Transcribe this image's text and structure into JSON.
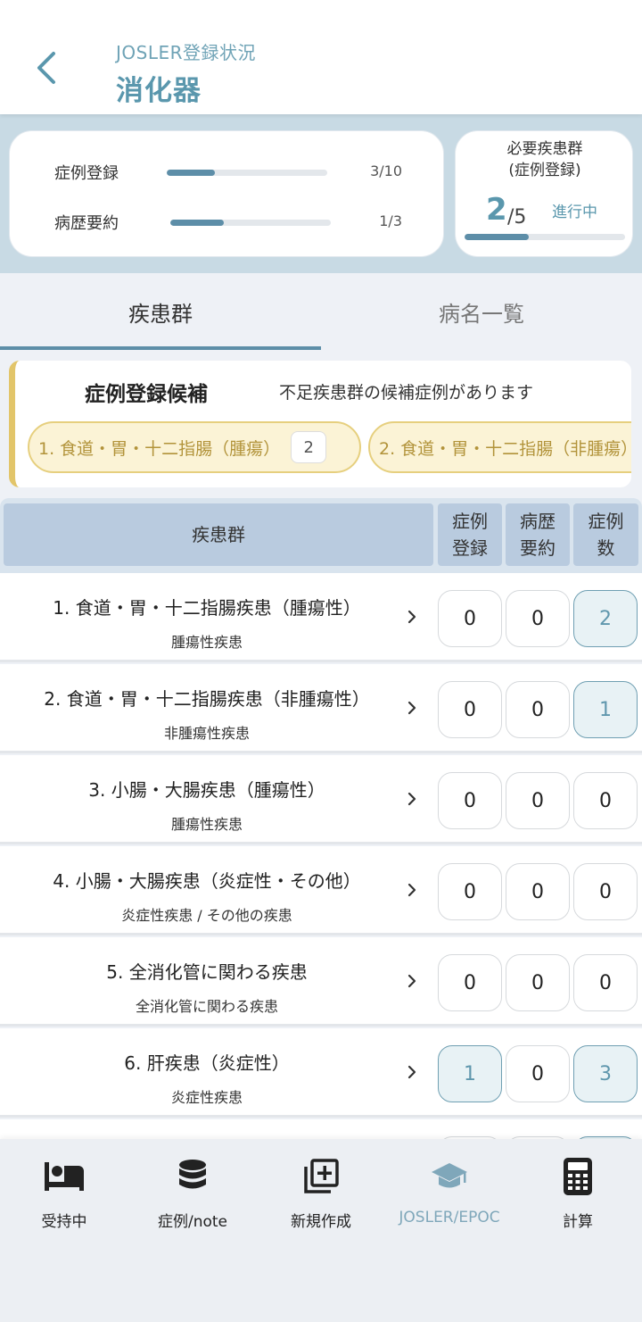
{
  "header": {
    "subtitle": "JOSLER登録状況",
    "title": "消化器"
  },
  "summary": {
    "progress": [
      {
        "label": "症例登録",
        "count": "3/10",
        "fraction": 0.3
      },
      {
        "label": "病歴要約",
        "count": "1/3",
        "fraction": 0.333
      }
    ],
    "required": {
      "title_line1": "必要疾患群",
      "title_line2": "(症例登録)",
      "done": "2",
      "total": "/5",
      "status": "進行中",
      "fraction": 0.4
    }
  },
  "tabs": [
    {
      "label": "疾患群",
      "active": true
    },
    {
      "label": "病名一覧",
      "active": false
    }
  ],
  "candidates": {
    "title": "症例登録候補",
    "subtitle": "不足疾患群の候補症例があります",
    "chips": [
      {
        "label": "1. 食道・胃・十二指腸（腫瘍）",
        "count": "2"
      },
      {
        "label": "2. 食道・胃・十二指腸（非腫瘍）",
        "count": ""
      }
    ]
  },
  "table": {
    "headers": {
      "group": "疾患群",
      "col1_line1": "症例",
      "col1_line2": "登録",
      "col2_line1": "病歴",
      "col2_line2": "要約",
      "col3_line1": "症例",
      "col3_line2": "数"
    },
    "rows": [
      {
        "name": "1. 食道・胃・十二指腸疾患（腫瘍性）",
        "sub": "腫瘍性疾患",
        "reg": "0",
        "summ": "0",
        "cases": "2",
        "hl": [
          false,
          false,
          true
        ]
      },
      {
        "name": "2. 食道・胃・十二指腸疾患（非腫瘍性）",
        "sub": "非腫瘍性疾患",
        "reg": "0",
        "summ": "0",
        "cases": "1",
        "hl": [
          false,
          false,
          true
        ]
      },
      {
        "name": "3. 小腸・大腸疾患（腫瘍性）",
        "sub": "腫瘍性疾患",
        "reg": "0",
        "summ": "0",
        "cases": "0",
        "hl": [
          false,
          false,
          false
        ]
      },
      {
        "name": "4. 小腸・大腸疾患（炎症性・その他）",
        "sub": "炎症性疾患 / その他の疾患",
        "reg": "0",
        "summ": "0",
        "cases": "0",
        "hl": [
          false,
          false,
          false
        ]
      },
      {
        "name": "5. 全消化管に関わる疾患",
        "sub": "全消化管に関わる疾患",
        "reg": "0",
        "summ": "0",
        "cases": "0",
        "hl": [
          false,
          false,
          false
        ]
      },
      {
        "name": "6. 肝疾患（炎症性）",
        "sub": "炎症性疾患",
        "reg": "1",
        "summ": "0",
        "cases": "3",
        "hl": [
          true,
          false,
          true
        ]
      }
    ]
  },
  "nav": [
    {
      "label": "受持中",
      "icon": "bed-icon",
      "active": false
    },
    {
      "label": "症例/note",
      "icon": "database-icon",
      "active": false
    },
    {
      "label": "新規作成",
      "icon": "add-box-icon",
      "active": false
    },
    {
      "label": "JOSLER/EPOC",
      "icon": "graduation-cap-icon",
      "active": true
    },
    {
      "label": "計算",
      "icon": "calculator-icon",
      "active": false
    }
  ],
  "colors": {
    "accent": "#5d8ea8",
    "accent_text": "#5a97ad",
    "candidate_border": "#e2c56a",
    "nav_active": "#7fa7ba"
  }
}
